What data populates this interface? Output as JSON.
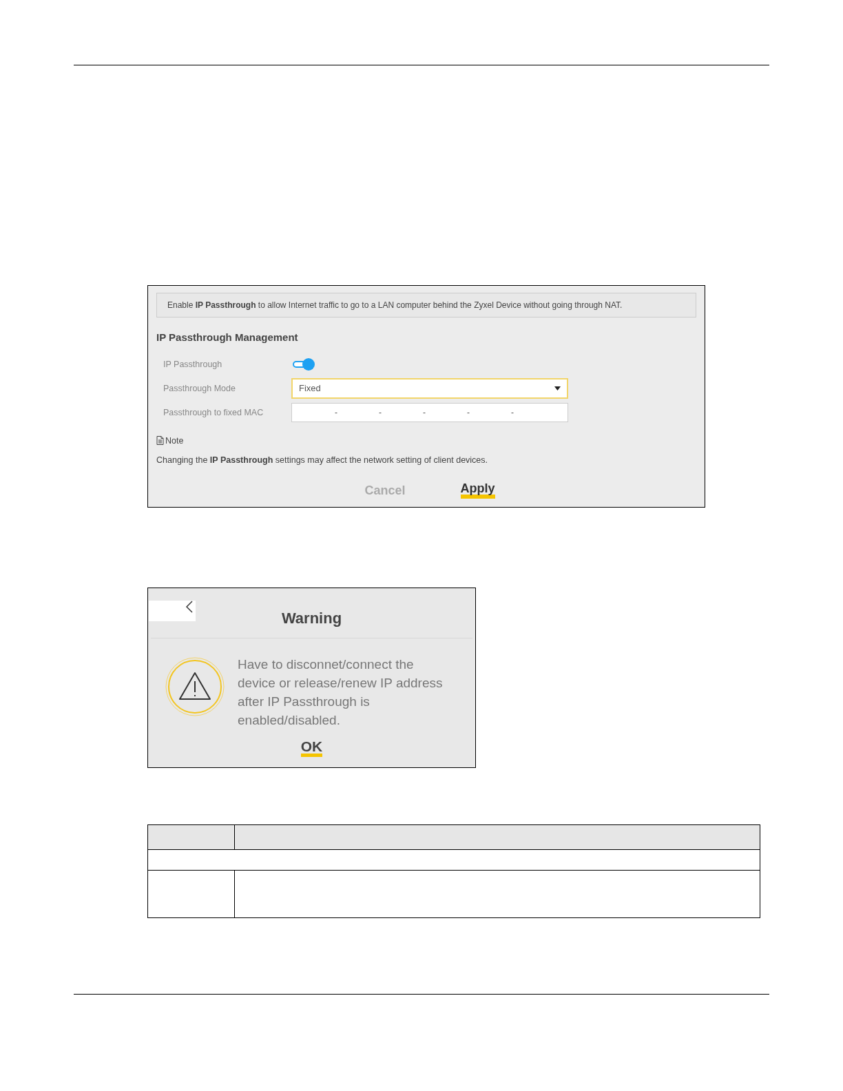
{
  "settings_panel": {
    "intro": "Enable **IP Passthrough** to allow Internet traffic to go to a LAN computer behind the Zyxel Device without going through NAT.",
    "heading": "IP Passthrough Management",
    "fields": [
      {
        "kind": "toggle",
        "label": "IP Passthrough",
        "on": true
      },
      {
        "kind": "select",
        "label": "Passthrough Mode",
        "value": "Fixed"
      },
      {
        "kind": "mac",
        "label": "Passthrough to fixed MAC",
        "separators": [
          "-",
          "-",
          "-",
          "-",
          "-"
        ]
      }
    ],
    "note": {
      "label": "Note",
      "text": "Changing the **IP Passthrough** settings may affect the network setting of client devices."
    },
    "buttons": [
      {
        "label": "Cancel",
        "disabled": true
      },
      {
        "label": "Apply",
        "disabled": false
      }
    ]
  },
  "warning_dialog": {
    "title": "Warning",
    "message": "Have to disconnet/connect the device or release/renew IP address after IP Passthrough is enabled/disabled.",
    "button": "OK"
  }
}
